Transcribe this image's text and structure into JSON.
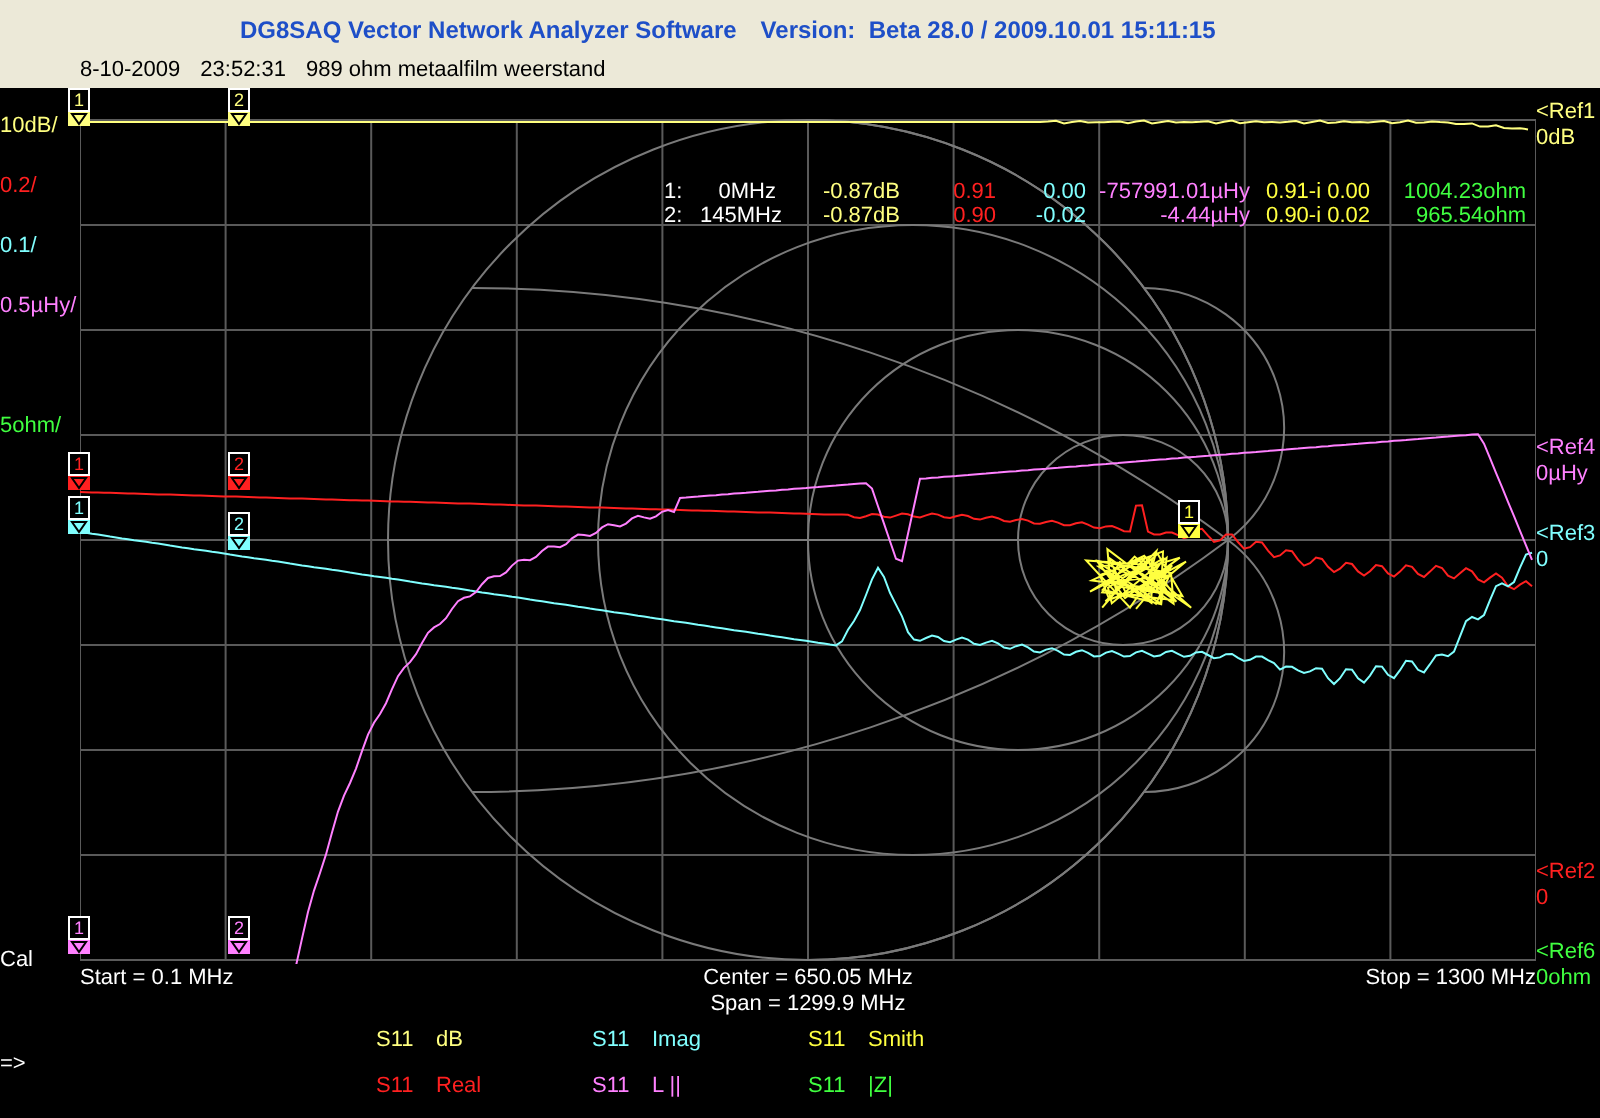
{
  "window": {
    "title": "DG8SAQ Vector Network Analyzer Software",
    "version": "Version:  Beta 28.0 / 2009.10.01 15:11:15"
  },
  "subtitle": {
    "date": "8-10-2009",
    "time": "23:52:31",
    "description": "989 ohm metaalfilm weerstand"
  },
  "scale_labels": [
    {
      "text": "10dB/",
      "color": "#ffff80"
    },
    {
      "text": "0.2/",
      "color": "#ff2020"
    },
    {
      "text": "0.1/",
      "color": "#80ffff"
    },
    {
      "text": "0.5µHy/",
      "color": "#ff80ff"
    },
    {
      "text": "5ohm/",
      "color": "#40ff40"
    }
  ],
  "ref_labels": [
    {
      "name": "<Ref1",
      "value": "0dB",
      "color": "#ffff80"
    },
    {
      "name": "<Ref4",
      "value": "0µHy",
      "color": "#ff80ff"
    },
    {
      "name": "<Ref3",
      "value": "0",
      "color": "#80ffff"
    },
    {
      "name": "<Ref2",
      "value": "0",
      "color": "#ff2020"
    },
    {
      "name": "<Ref6",
      "value": "0ohm",
      "color": "#40ff40"
    }
  ],
  "marker_table": {
    "columns": [
      {
        "color": "#ffffff"
      },
      {
        "color": "#ffffff"
      },
      {
        "color": "#ffff80"
      },
      {
        "color": "#ff2020"
      },
      {
        "color": "#80ffff"
      },
      {
        "color": "#ff80ff"
      },
      {
        "color": "#ffff40"
      },
      {
        "color": "#40ff40"
      }
    ],
    "rows": [
      {
        "cells": [
          "1:",
          "0MHz",
          "-0.87dB",
          "0.91",
          "0.00",
          "-757991.01µHy",
          "0.91-i 0.00",
          "1004.23ohm"
        ]
      },
      {
        "cells": [
          "2:",
          "145MHz",
          "-0.87dB",
          "0.90",
          "-0.02",
          "-4.44µHy",
          "0.90-i 0.02",
          "965.54ohm"
        ]
      }
    ]
  },
  "traces": [
    {
      "kind": "db",
      "color": "#ffff80",
      "markers": [
        "1",
        "2"
      ]
    },
    {
      "kind": "real",
      "color": "#ff2020",
      "markers": [
        "1",
        "2"
      ]
    },
    {
      "kind": "imag",
      "color": "#80ffff",
      "markers": [
        "1",
        "2"
      ]
    },
    {
      "kind": "inductance",
      "color": "#ff80ff",
      "markers": [
        "1",
        "2"
      ]
    },
    {
      "kind": "smith",
      "color": "#ffff40",
      "markers": [
        "1"
      ]
    }
  ],
  "cal_label": "Cal",
  "axis": {
    "start": "Start = 0.1 MHz",
    "center": "Center = 650.05 MHz",
    "span": "Span = 1299.9 MHz",
    "stop": "Stop = 1300 MHz"
  },
  "prompt": "=>",
  "legend": [
    {
      "param": "S11",
      "trace": "dB",
      "color": "#ffff80"
    },
    {
      "param": "S11",
      "trace": "Imag",
      "color": "#80ffff"
    },
    {
      "param": "S11",
      "trace": "Smith",
      "color": "#ffff40"
    },
    {
      "param": "S11",
      "trace": "Real",
      "color": "#ff2020"
    },
    {
      "param": "S11",
      "trace": "L ||",
      "color": "#ff80ff"
    },
    {
      "param": "S11",
      "trace": "|Z|",
      "color": "#40ff40"
    }
  ]
}
